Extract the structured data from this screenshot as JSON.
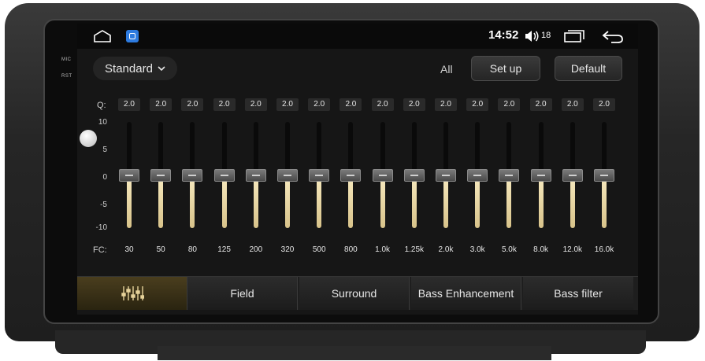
{
  "hardware": {
    "mic_label": "MIC",
    "rst_label": "RST"
  },
  "statusbar": {
    "time": "14:52",
    "volume": "18",
    "icons": [
      "home-icon",
      "app-icon",
      "volume-icon",
      "recent-apps-icon",
      "back-icon"
    ]
  },
  "header": {
    "preset": "Standard",
    "all_label": "All",
    "setup_label": "Set up",
    "default_label": "Default"
  },
  "eq": {
    "q_label": "Q:",
    "fc_label": "FC:",
    "scale": [
      "10",
      "5",
      "0",
      "-5",
      "-10"
    ],
    "range": [
      -10,
      10
    ],
    "bands": [
      {
        "fc": "30",
        "q": "2.0",
        "gain": 0
      },
      {
        "fc": "50",
        "q": "2.0",
        "gain": 0
      },
      {
        "fc": "80",
        "q": "2.0",
        "gain": 0
      },
      {
        "fc": "125",
        "q": "2.0",
        "gain": 0
      },
      {
        "fc": "200",
        "q": "2.0",
        "gain": 0
      },
      {
        "fc": "320",
        "q": "2.0",
        "gain": 0
      },
      {
        "fc": "500",
        "q": "2.0",
        "gain": 0
      },
      {
        "fc": "800",
        "q": "2.0",
        "gain": 0
      },
      {
        "fc": "1.0k",
        "q": "2.0",
        "gain": 0
      },
      {
        "fc": "1.25k",
        "q": "2.0",
        "gain": 0
      },
      {
        "fc": "2.0k",
        "q": "2.0",
        "gain": 0
      },
      {
        "fc": "3.0k",
        "q": "2.0",
        "gain": 0
      },
      {
        "fc": "5.0k",
        "q": "2.0",
        "gain": 0
      },
      {
        "fc": "8.0k",
        "q": "2.0",
        "gain": 0
      },
      {
        "fc": "12.0k",
        "q": "2.0",
        "gain": 0
      },
      {
        "fc": "16.0k",
        "q": "2.0",
        "gain": 0
      }
    ]
  },
  "tabs": [
    {
      "label": "",
      "icon": "equalizer-icon",
      "active": true
    },
    {
      "label": "Field",
      "active": false
    },
    {
      "label": "Surround",
      "active": false
    },
    {
      "label": "Bass Enhancement",
      "active": false
    },
    {
      "label": "Bass filter",
      "active": false
    }
  ],
  "colors": {
    "accent_gold": "#d8c38a",
    "active_tab": "#4a3e1e"
  }
}
